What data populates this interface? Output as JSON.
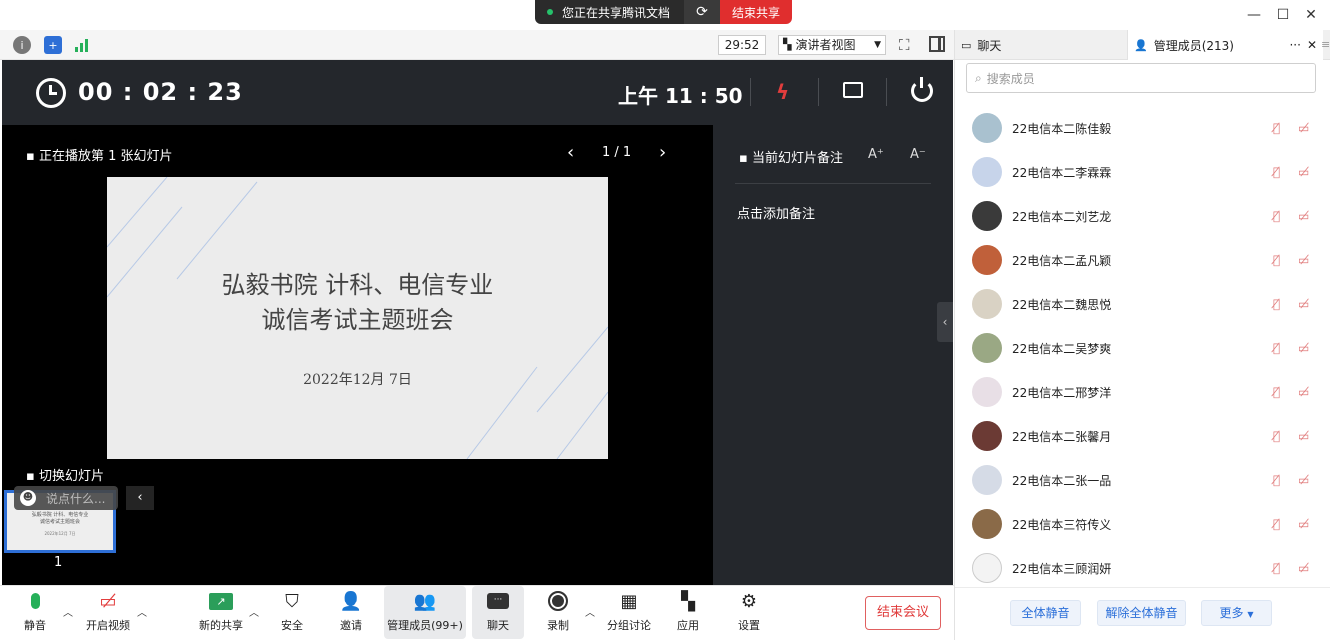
{
  "share_bar": {
    "status": "您正在共享腾讯文档",
    "stop_label": "结束共享"
  },
  "window_controls": [
    "minimize",
    "maximize",
    "close"
  ],
  "toolbar": {
    "duration": "29:52",
    "view_mode": "演讲者视图"
  },
  "presenter": {
    "elapsed": "00 : 02 : 23",
    "clock": "上午 11 : 50",
    "slide_caption": "正在播放第 1 张幻灯片",
    "page_indicator": "1 / 1",
    "slide": {
      "line1": "弘毅书院 计科、电信专业",
      "line2": "诚信考试主题班会",
      "date": "2022年12月 7日"
    },
    "switch_caption": "切换幻灯片",
    "thumb_number": "1",
    "chat_placeholder": "说点什么...",
    "notes_title": "当前幻灯片备注",
    "notes_font_up": "A⁺",
    "notes_font_down": "A⁻",
    "notes_add": "点击添加备注"
  },
  "bottom_bar": {
    "mute": "静音",
    "video": "开启视频",
    "new_share": "新的共享",
    "security": "安全",
    "invite": "邀请",
    "members": "管理成员(99+)",
    "chat": "聊天",
    "record": "录制",
    "breakout": "分组讨论",
    "apps": "应用",
    "settings": "设置",
    "end_meeting": "结束会议"
  },
  "right_panel": {
    "tab_chat": "聊天",
    "tab_members": "管理成员(213)",
    "search_placeholder": "搜索成员",
    "members": [
      {
        "name": "22电信本二陈佳毅",
        "avatar_color": "#a9c1cf"
      },
      {
        "name": "22电信本二李霖霖",
        "avatar_color": "#c7d4ea"
      },
      {
        "name": "22电信本二刘艺龙",
        "avatar_color": "#3a3a3a"
      },
      {
        "name": "22电信本二孟凡颖",
        "avatar_color": "#c0603a"
      },
      {
        "name": "22电信本二魏思悦",
        "avatar_color": "#d9d2c4"
      },
      {
        "name": "22电信本二吴梦爽",
        "avatar_color": "#9aa884"
      },
      {
        "name": "22电信本二邢梦洋",
        "avatar_color": "#e8dfe6"
      },
      {
        "name": "22电信本二张馨月",
        "avatar_color": "#6b3a34"
      },
      {
        "name": "22电信本二张一品",
        "avatar_color": "#d5dbe6"
      },
      {
        "name": "22电信本三符传义",
        "avatar_color": "#8a6a48"
      },
      {
        "name": "22电信本三顾润妍",
        "avatar_color": "#f3f3f3"
      }
    ],
    "mute_all": "全体静音",
    "unmute_all": "解除全体静音",
    "more": "更多"
  }
}
